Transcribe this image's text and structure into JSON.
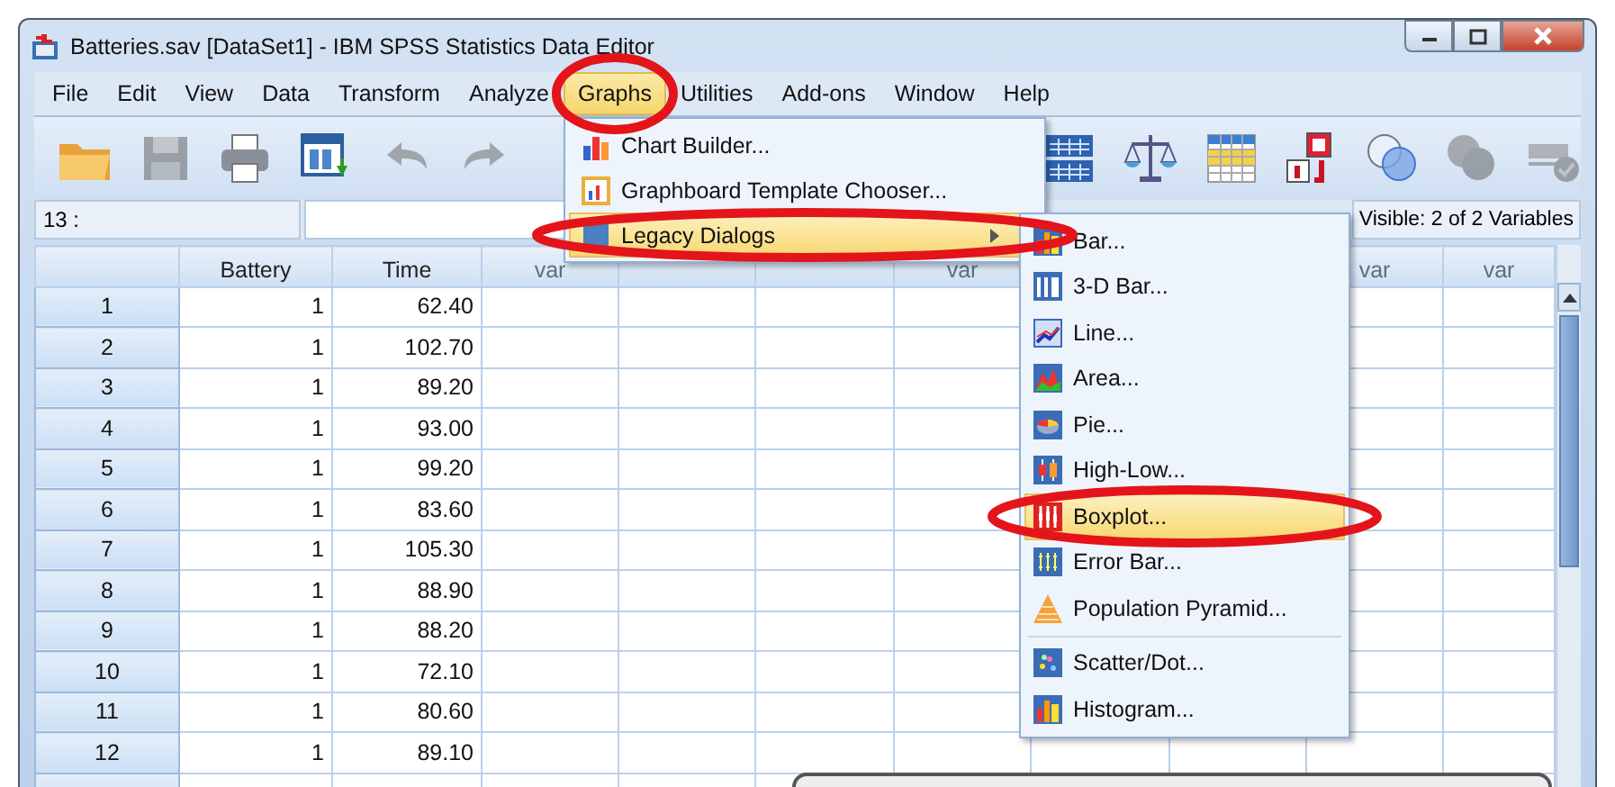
{
  "window": {
    "title": "Batteries.sav [DataSet1] - IBM SPSS Statistics Data Editor"
  },
  "menu": [
    {
      "label": "File",
      "selected": false
    },
    {
      "label": "Edit",
      "selected": false
    },
    {
      "label": "View",
      "selected": false
    },
    {
      "label": "Data",
      "selected": false
    },
    {
      "label": "Transform",
      "selected": false
    },
    {
      "label": "Analyze",
      "selected": false
    },
    {
      "label": "Graphs",
      "selected": true,
      "circled": true
    },
    {
      "label": "Utilities",
      "selected": false
    },
    {
      "label": "Add-ons",
      "selected": false
    },
    {
      "label": "Window",
      "selected": false
    },
    {
      "label": "Help",
      "selected": false
    }
  ],
  "toolbar": [
    {
      "disabled": false
    },
    {
      "disabled": true
    },
    {
      "disabled": false
    },
    {
      "disabled": false
    },
    {
      "disabled": true
    },
    {
      "disabled": true
    },
    {
      "disabled": false
    },
    {
      "disabled": false
    },
    {
      "disabled": false
    },
    {
      "disabled": false
    },
    {
      "disabled": false
    },
    {
      "disabled": true
    },
    {
      "disabled": true
    }
  ],
  "cell_reference": "13 :",
  "variables_status": "Visible: 2 of 2 Variables",
  "grid": {
    "columns": [
      {
        "kind": "named",
        "label": "Battery"
      },
      {
        "kind": "named",
        "label": "Time"
      },
      {
        "kind": "named",
        "label": "var"
      },
      {
        "kind": "covered"
      },
      {
        "kind": "covered"
      },
      {
        "kind": "named",
        "label": "var"
      },
      {
        "kind": "covered"
      },
      {
        "kind": "covered"
      },
      {
        "kind": "named",
        "label": "var"
      },
      {
        "kind": "named",
        "label": "var"
      }
    ],
    "rows": [
      {
        "number": "1",
        "cells": [
          "1",
          "62.40"
        ]
      },
      {
        "number": "2",
        "cells": [
          "1",
          "102.70"
        ]
      },
      {
        "number": "3",
        "cells": [
          "1",
          "89.20"
        ]
      },
      {
        "number": "4",
        "cells": [
          "1",
          "93.00"
        ]
      },
      {
        "number": "5",
        "cells": [
          "1",
          "99.20"
        ]
      },
      {
        "number": "6",
        "cells": [
          "1",
          "83.60"
        ]
      },
      {
        "number": "7",
        "cells": [
          "1",
          "105.30"
        ]
      },
      {
        "number": "8",
        "cells": [
          "1",
          "88.90"
        ]
      },
      {
        "number": "9",
        "cells": [
          "1",
          "88.20"
        ]
      },
      {
        "number": "10",
        "cells": [
          "1",
          "72.10"
        ]
      },
      {
        "number": "11",
        "cells": [
          "1",
          "80.60"
        ]
      },
      {
        "number": "12",
        "cells": [
          "1",
          "89.10"
        ]
      }
    ]
  },
  "graphs_menu": {
    "items": [
      {
        "label": "Chart Builder...",
        "selected": false,
        "has_submenu": false
      },
      {
        "label": "Graphboard Template Chooser...",
        "selected": false,
        "has_submenu": false
      },
      {
        "label": "Legacy Dialogs",
        "selected": true,
        "has_submenu": true,
        "circled": true
      }
    ]
  },
  "legacy_submenu": {
    "items": [
      {
        "label": "Bar...",
        "selected": false
      },
      {
        "label": "3-D Bar...",
        "selected": false
      },
      {
        "label": "Line...",
        "selected": false
      },
      {
        "label": "Area...",
        "selected": false
      },
      {
        "label": "Pie...",
        "selected": false
      },
      {
        "label": "High-Low...",
        "selected": false
      },
      {
        "label": "Boxplot...",
        "selected": true,
        "circled": true
      },
      {
        "label": "Error Bar...",
        "selected": false
      },
      {
        "label": "Population Pyramid...",
        "selected": false
      },
      {
        "label": "Scatter/Dot...",
        "selected": false,
        "separator_before": true
      },
      {
        "label": "Histogram...",
        "selected": false
      }
    ]
  }
}
